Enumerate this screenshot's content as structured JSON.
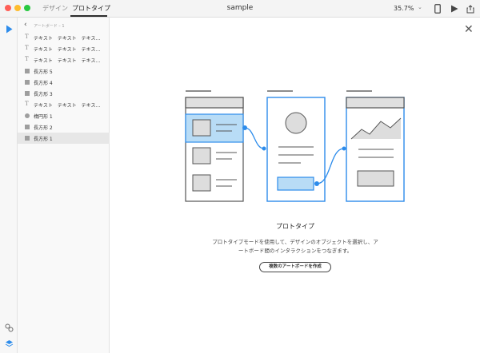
{
  "window": {
    "tabs": {
      "design": "デザイン",
      "prototype": "プロトタイプ"
    },
    "title": "sample",
    "zoom": "35.7%"
  },
  "layers_panel": {
    "artboard_name": "アートボード – 1",
    "items": [
      {
        "type": "text",
        "label": "テキスト　テキスト　テキス…"
      },
      {
        "type": "text",
        "label": "テキスト　テキスト　テキス…"
      },
      {
        "type": "text",
        "label": "テキスト　テキスト　テキス…"
      },
      {
        "type": "rect",
        "label": "長方形 5"
      },
      {
        "type": "rect",
        "label": "長方形 4"
      },
      {
        "type": "rect",
        "label": "長方形 3"
      },
      {
        "type": "text",
        "label": "テキスト　テキスト　テキス…"
      },
      {
        "type": "ellipse",
        "label": "楕円形 1"
      },
      {
        "type": "rect",
        "label": "長方形 2"
      },
      {
        "type": "rect",
        "label": "長方形 1",
        "selected": true
      }
    ]
  },
  "canvas": {
    "title": "プロトタイプ",
    "description": "プロトタイプモードを使用して、デザインのオブジェクトを選択し、アートボード間のインタラクションをつなぎます。",
    "button_label": "複数のアートボードを作成"
  },
  "colors": {
    "accent": "#2d8ceb",
    "highlight_fill": "#b8dcf6"
  }
}
